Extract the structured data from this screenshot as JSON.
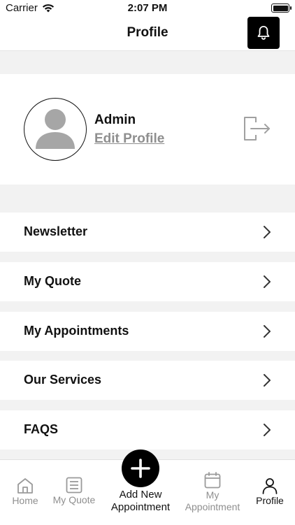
{
  "status_bar": {
    "carrier": "Carrier",
    "time": "2:07 PM"
  },
  "nav": {
    "title": "Profile"
  },
  "profile": {
    "name": "Admin",
    "edit_label": "Edit Profile"
  },
  "menu": [
    {
      "label": "Newsletter"
    },
    {
      "label": "My Quote"
    },
    {
      "label": "My Appointments"
    },
    {
      "label": "Our Services"
    },
    {
      "label": "FAQS"
    }
  ],
  "tabs": {
    "home": "Home",
    "my_quote": "My Quote",
    "add_new": "Add New Appointment",
    "my_appointment": "My Appointment",
    "profile": "Profile"
  },
  "icons": {
    "notification": "bell-icon",
    "logout": "logout-icon",
    "chevron": "chevron-right-icon",
    "add": "plus-icon"
  },
  "colors": {
    "accent": "#000000",
    "muted": "#8f8f8f",
    "background": "#f2f2f2"
  }
}
